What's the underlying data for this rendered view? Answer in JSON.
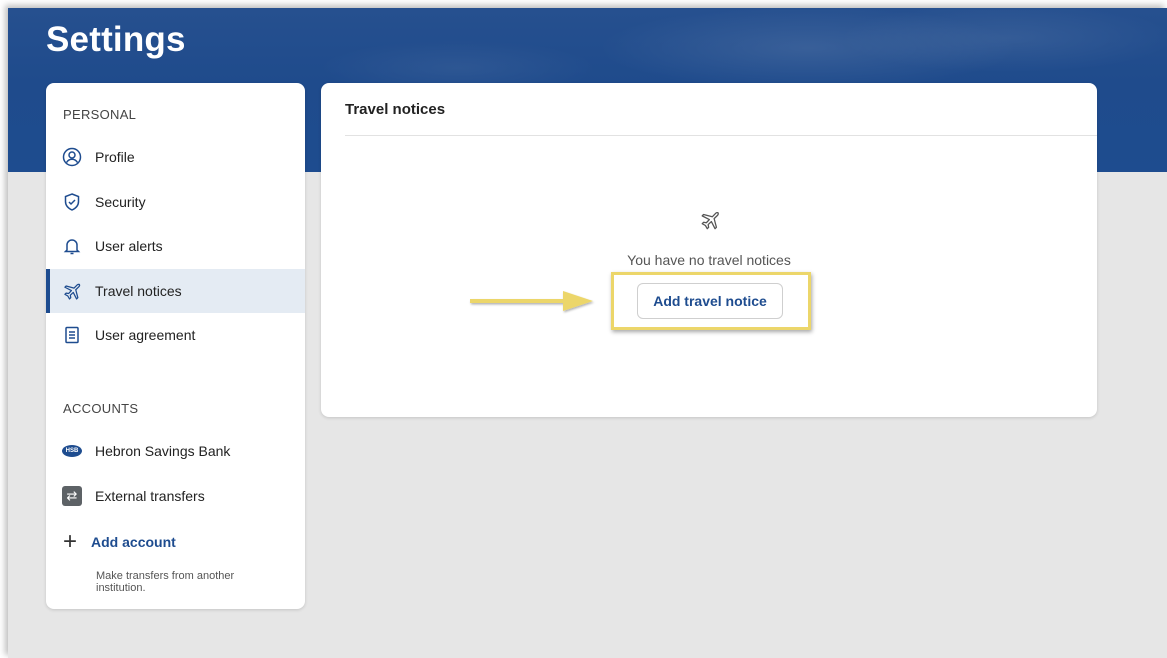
{
  "page": {
    "title": "Settings"
  },
  "sidebar": {
    "personal_heading": "PERSONAL",
    "personal_items": [
      {
        "label": "Profile",
        "icon": "user-circle-icon"
      },
      {
        "label": "Security",
        "icon": "shield-check-icon"
      },
      {
        "label": "User alerts",
        "icon": "bell-icon"
      },
      {
        "label": "Travel notices",
        "icon": "airplane-icon",
        "active": true
      },
      {
        "label": "User agreement",
        "icon": "document-icon"
      }
    ],
    "accounts_heading": "ACCOUNTS",
    "account_items": [
      {
        "label": "Hebron Savings Bank",
        "icon": "bank-logo-icon",
        "logo_text": "HSB"
      },
      {
        "label": "External transfers",
        "icon": "transfer-icon"
      }
    ],
    "add_account": {
      "label": "Add account",
      "description": "Make transfers from another institution."
    }
  },
  "main": {
    "card_title": "Travel notices",
    "empty_message": "You have no travel notices",
    "add_button_label": "Add travel notice"
  },
  "colors": {
    "brand": "#1e4c8f",
    "highlight": "#ecd66a",
    "arrow": "#ecd66a"
  }
}
